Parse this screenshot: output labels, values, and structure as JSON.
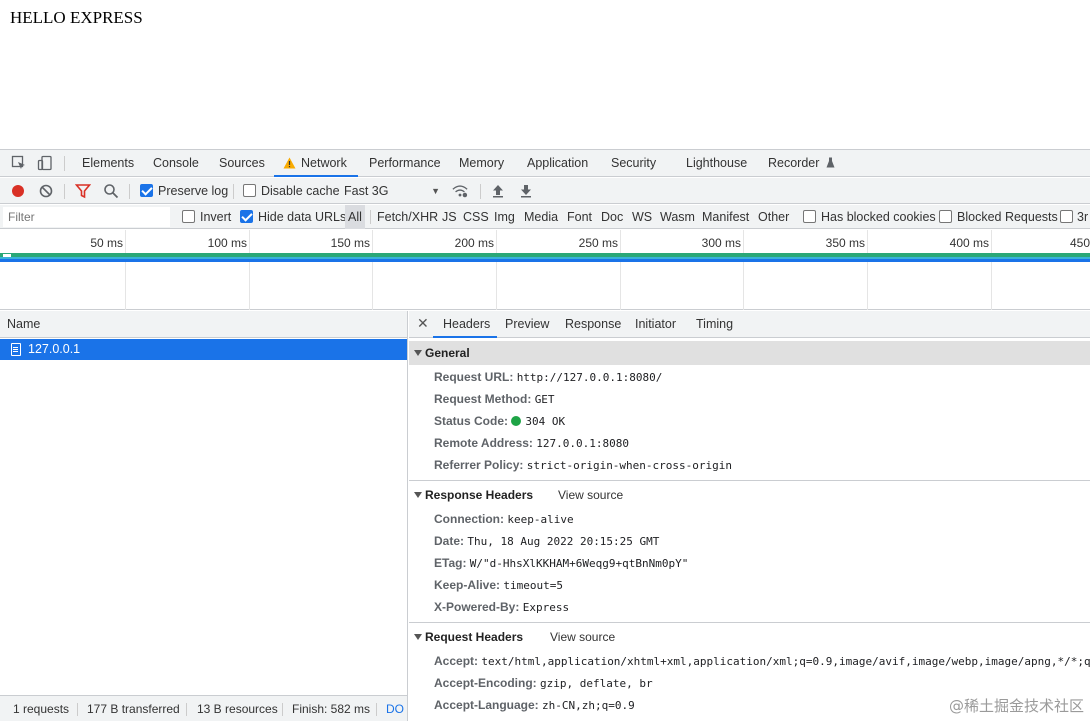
{
  "page": {
    "text": "HELLO EXPRESS"
  },
  "devtools": {
    "tabs": [
      "Elements",
      "Console",
      "Sources",
      "Network",
      "Performance",
      "Memory",
      "Application",
      "Security",
      "Lighthouse",
      "Recorder"
    ],
    "active_tab": "Network",
    "toolbar": {
      "preserve_log": "Preserve log",
      "disable_cache": "Disable cache",
      "throttle": "Fast 3G"
    },
    "filterbar": {
      "placeholder": "Filter",
      "invert": "Invert",
      "hide_data_urls": "Hide data URLs",
      "types": [
        "All",
        "Fetch/XHR",
        "JS",
        "CSS",
        "Img",
        "Media",
        "Font",
        "Doc",
        "WS",
        "Wasm",
        "Manifest",
        "Other"
      ],
      "has_blocked_cookies": "Has blocked cookies",
      "blocked_requests": "Blocked Requests",
      "third_party": "3r"
    },
    "overview": {
      "ticks": [
        "50 ms",
        "100 ms",
        "150 ms",
        "200 ms",
        "250 ms",
        "300 ms",
        "350 ms",
        "400 ms",
        "450"
      ]
    },
    "name_panel": {
      "header": "Name",
      "rows": [
        {
          "name": "127.0.0.1"
        }
      ]
    },
    "detail_tabs": [
      "Headers",
      "Preview",
      "Response",
      "Initiator",
      "Timing"
    ],
    "general": {
      "title": "General",
      "rows": [
        {
          "key": "Request URL:",
          "value": "http://127.0.0.1:8080/"
        },
        {
          "key": "Request Method:",
          "value": "GET"
        },
        {
          "key": "Status Code:",
          "value": "304 OK"
        },
        {
          "key": "Remote Address:",
          "value": "127.0.0.1:8080"
        },
        {
          "key": "Referrer Policy:",
          "value": "strict-origin-when-cross-origin"
        }
      ]
    },
    "response_headers": {
      "title": "Response Headers",
      "view_source": "View source",
      "rows": [
        {
          "key": "Connection:",
          "value": "keep-alive"
        },
        {
          "key": "Date:",
          "value": "Thu, 18 Aug 2022 20:15:25 GMT"
        },
        {
          "key": "ETag:",
          "value": "W/\"d-HhsXlKKHAM+6Weqg9+qtBnNm0pY\""
        },
        {
          "key": "Keep-Alive:",
          "value": "timeout=5"
        },
        {
          "key": "X-Powered-By:",
          "value": "Express"
        }
      ]
    },
    "request_headers": {
      "title": "Request Headers",
      "view_source": "View source",
      "rows": [
        {
          "key": "Accept:",
          "value": "text/html,application/xhtml+xml,application/xml;q=0.9,image/avif,image/webp,image/apng,*/*;q"
        },
        {
          "key": "Accept-Encoding:",
          "value": "gzip, deflate, br"
        },
        {
          "key": "Accept-Language:",
          "value": "zh-CN,zh;q=0.9"
        }
      ]
    },
    "statusbar": {
      "requests": "1 requests",
      "transferred": "177 B transferred",
      "resources": "13 B resources",
      "finish": "Finish: 582 ms",
      "dom": "DO"
    },
    "colors": {
      "accent": "#1a73e8",
      "status_ok": "#1ea446",
      "record": "#d93025"
    }
  },
  "watermark": "@稀土掘金技术社区"
}
